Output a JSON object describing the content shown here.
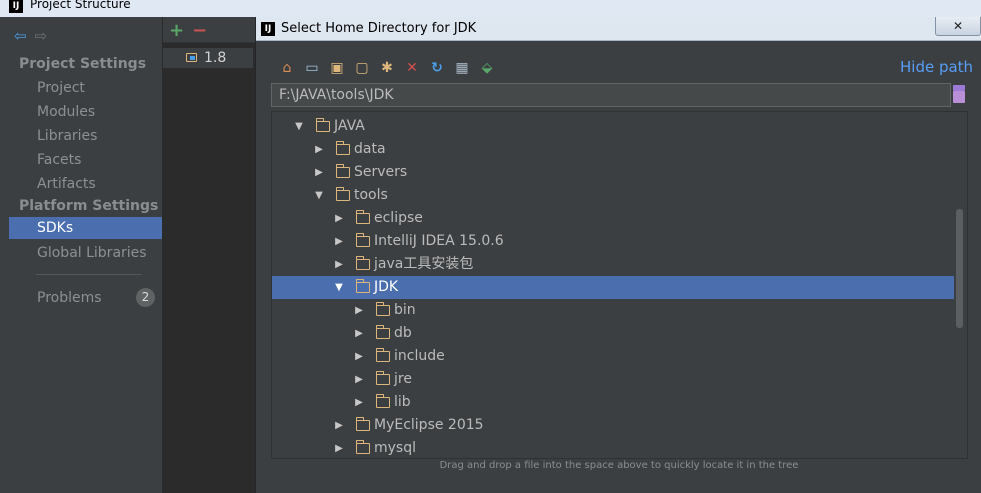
{
  "window": {
    "title": "Project Structure",
    "app_icon": "IJ"
  },
  "left_nav": {
    "sections": [
      {
        "title": "Project Settings",
        "items": [
          "Project",
          "Modules",
          "Libraries",
          "Facets",
          "Artifacts"
        ]
      },
      {
        "title": "Platform Settings",
        "items": [
          "SDKs",
          "Global Libraries"
        ]
      }
    ],
    "selected": "SDKs",
    "problems": {
      "label": "Problems",
      "count": "2"
    }
  },
  "sdk_panel": {
    "sdks": [
      "1.8"
    ]
  },
  "dialog": {
    "title": "Select Home Directory for JDK",
    "close_label": "✕",
    "hide_path_label": "Hide path",
    "path_value": "F:\\JAVA\\tools\\JDK",
    "hint": "Drag and drop a file into the space above to quickly locate it in the tree",
    "toolbar_icons": [
      "home-icon",
      "desktop-icon",
      "project-folder-icon",
      "module-folder-icon",
      "new-folder-icon",
      "delete-icon",
      "refresh-icon",
      "show-hidden-icon",
      "attach-icon"
    ],
    "tree": [
      {
        "label": "JAVA",
        "depth": 0,
        "expanded": true
      },
      {
        "label": "data",
        "depth": 1,
        "expanded": false
      },
      {
        "label": "Servers",
        "depth": 1,
        "expanded": false
      },
      {
        "label": "tools",
        "depth": 1,
        "expanded": true
      },
      {
        "label": "eclipse",
        "depth": 2,
        "expanded": false
      },
      {
        "label": "IntelliJ IDEA 15.0.6",
        "depth": 2,
        "expanded": false
      },
      {
        "label": "java工具安装包",
        "depth": 2,
        "expanded": false
      },
      {
        "label": "JDK",
        "depth": 2,
        "expanded": true,
        "selected": true
      },
      {
        "label": "bin",
        "depth": 3,
        "expanded": false
      },
      {
        "label": "db",
        "depth": 3,
        "expanded": false
      },
      {
        "label": "include",
        "depth": 3,
        "expanded": false
      },
      {
        "label": "jre",
        "depth": 3,
        "expanded": false
      },
      {
        "label": "lib",
        "depth": 3,
        "expanded": false
      },
      {
        "label": "MyEclipse 2015",
        "depth": 2,
        "expanded": false
      },
      {
        "label": "mysql",
        "depth": 2,
        "expanded": false
      }
    ]
  },
  "colors": {
    "background": "#3c3f41",
    "selection": "#4b6eaf",
    "link": "#589df6",
    "folder": "#dcb67a"
  }
}
